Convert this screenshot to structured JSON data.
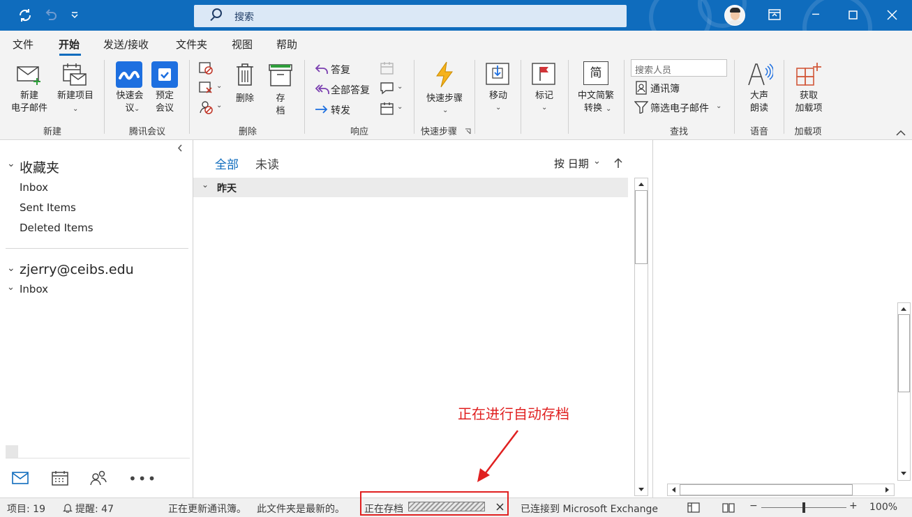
{
  "titlebar": {
    "search_placeholder": "搜索",
    "accent": "#0f6cbd"
  },
  "menu": {
    "tabs": [
      "文件",
      "开始",
      "发送/接收",
      "文件夹",
      "视图",
      "帮助"
    ],
    "active": "开始"
  },
  "ribbon": {
    "new": {
      "new_email": [
        "新建",
        "电子邮件"
      ],
      "new_item": "新建项目",
      "group": "新建"
    },
    "tencent": {
      "quick_meeting": [
        "快速会",
        "议"
      ],
      "schedule_meeting": [
        "预定",
        "会议"
      ],
      "group": "腾讯会议"
    },
    "delete": {
      "delete": "删除",
      "archive": [
        "存",
        "档"
      ],
      "group": "删除"
    },
    "respond": {
      "reply": "答复",
      "reply_all": "全部答复",
      "forward": "转发",
      "group": "响应"
    },
    "quicksteps": {
      "label": "快速步骤",
      "group": "快速步骤"
    },
    "move": {
      "label": "移动"
    },
    "tags": {
      "label": "标记"
    },
    "chinese": {
      "label": [
        "中文简繁",
        "转换"
      ],
      "icon_char": "简"
    },
    "find": {
      "search_people_placeholder": "搜索人员",
      "address_book": "通讯簿",
      "filter_email": "筛选电子邮件",
      "group": "查找"
    },
    "speech": {
      "label": [
        "大声",
        "朗读"
      ],
      "group": "语音"
    },
    "addins": {
      "label": [
        "获取",
        "加载项"
      ],
      "group": "加载项"
    }
  },
  "sidebar": {
    "favorites_header": "收藏夹",
    "favorites": [
      "Inbox",
      "Sent Items",
      "Deleted Items"
    ],
    "account": "zjerry@ceibs.edu",
    "account_items": [
      "Inbox"
    ]
  },
  "list": {
    "tab_all": "全部",
    "tab_unread": "未读",
    "sort": "按 日期",
    "group_yesterday": "昨天"
  },
  "status": {
    "items": "项目: 19",
    "reminders": "提醒: 47",
    "updating": "正在更新通讯簿。",
    "uptodate": "此文件夹是最新的。",
    "archiving": "正在存档",
    "connected": "已连接到 Microsoft Exchange",
    "zoom": "100%",
    "zoom_level": 0.5
  },
  "annotation": {
    "text": "正在进行自动存档",
    "color": "#e02020"
  }
}
